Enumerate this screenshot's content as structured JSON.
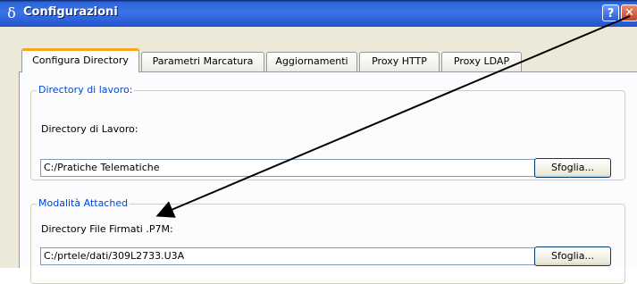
{
  "window": {
    "title": "Configurazioni",
    "app_icon_glyph": "δ",
    "help_glyph": "?",
    "close_glyph": "✕"
  },
  "tabs": [
    {
      "label": "Configura Directory",
      "active": true
    },
    {
      "label": "Parametri Marcatura",
      "active": false
    },
    {
      "label": "Aggiornamenti",
      "active": false
    },
    {
      "label": "Proxy HTTP",
      "active": false
    },
    {
      "label": "Proxy LDAP",
      "active": false
    }
  ],
  "work_dir_group": {
    "title": "Directory di lavoro:",
    "field_label": "Directory di Lavoro:",
    "value": "C:/Pratiche Telematiche",
    "browse_label": "Sfoglia..."
  },
  "attached_group": {
    "title": "Modalità Attached",
    "field_label": "Directory File Firmati .P7M:",
    "value": "C:/prtele/dati/309L2733.U3A",
    "browse_label": "Sfoglia..."
  },
  "colors": {
    "titlebar": "#2b5fd6",
    "group_title": "#0046d5",
    "active_tab_accent": "#f5a623",
    "arrow": "#000000"
  }
}
